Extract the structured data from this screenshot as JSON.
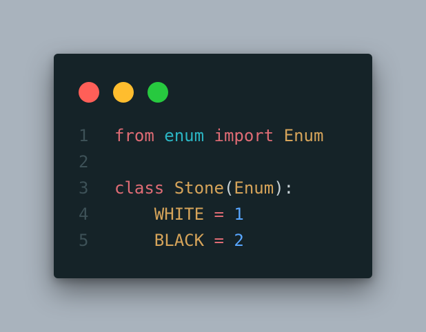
{
  "window": {
    "controls": [
      {
        "name": "close",
        "color": "#ff5f58"
      },
      {
        "name": "minimize",
        "color": "#ffbd2e"
      },
      {
        "name": "maximize",
        "color": "#27c93f"
      }
    ]
  },
  "code": {
    "language": "python",
    "lines": [
      {
        "num": "1",
        "tokens": [
          {
            "t": "from",
            "k": "kw"
          },
          {
            "t": " ",
            "k": "ws"
          },
          {
            "t": "enum",
            "k": "mod"
          },
          {
            "t": " ",
            "k": "ws"
          },
          {
            "t": "import",
            "k": "kw"
          },
          {
            "t": " ",
            "k": "ws"
          },
          {
            "t": "Enum",
            "k": "cls"
          }
        ]
      },
      {
        "num": "2",
        "tokens": []
      },
      {
        "num": "3",
        "tokens": [
          {
            "t": "class",
            "k": "kw"
          },
          {
            "t": " ",
            "k": "ws"
          },
          {
            "t": "Stone",
            "k": "cls"
          },
          {
            "t": "(",
            "k": "punc"
          },
          {
            "t": "Enum",
            "k": "cls"
          },
          {
            "t": "):",
            "k": "punc"
          }
        ]
      },
      {
        "num": "4",
        "tokens": [
          {
            "t": "    ",
            "k": "ws"
          },
          {
            "t": "WHITE",
            "k": "ident"
          },
          {
            "t": " ",
            "k": "ws"
          },
          {
            "t": "=",
            "k": "op"
          },
          {
            "t": " ",
            "k": "ws"
          },
          {
            "t": "1",
            "k": "num"
          }
        ]
      },
      {
        "num": "5",
        "tokens": [
          {
            "t": "    ",
            "k": "ws"
          },
          {
            "t": "BLACK",
            "k": "ident"
          },
          {
            "t": " ",
            "k": "ws"
          },
          {
            "t": "=",
            "k": "op"
          },
          {
            "t": " ",
            "k": "ws"
          },
          {
            "t": "2",
            "k": "num"
          }
        ]
      }
    ]
  }
}
